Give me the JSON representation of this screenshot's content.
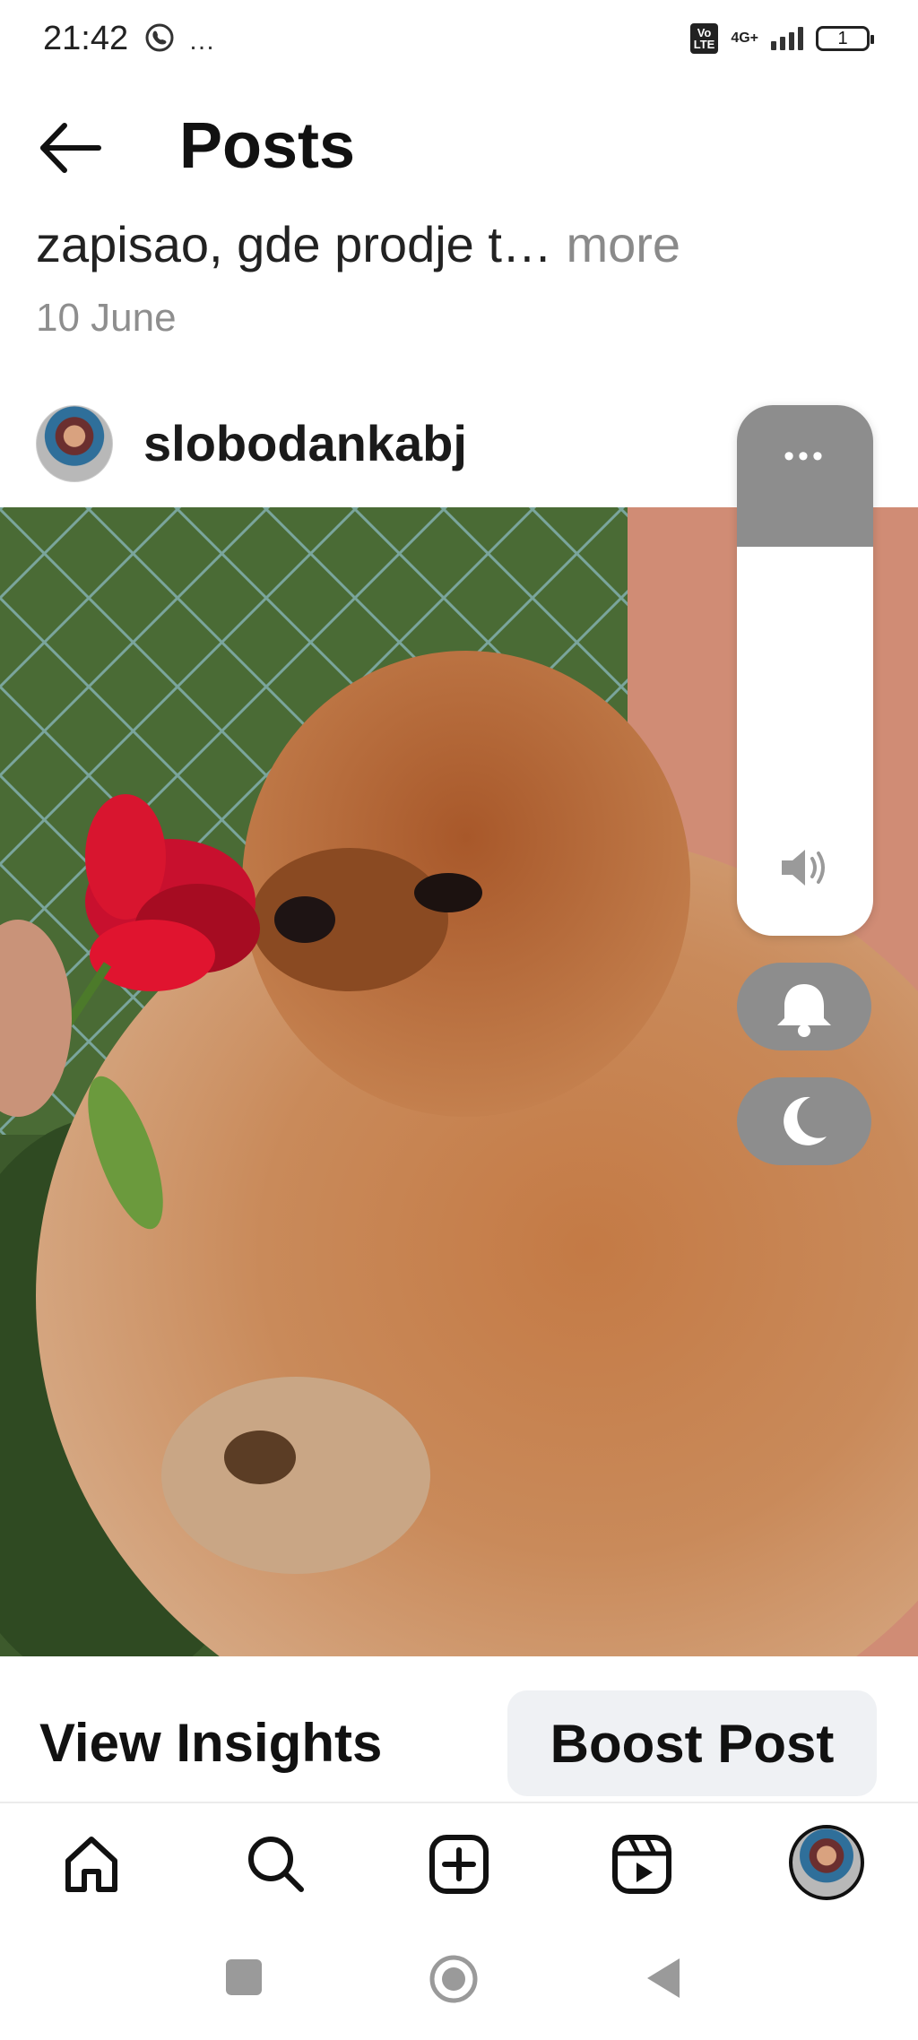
{
  "status_bar": {
    "time": "21:42",
    "extra": "…",
    "network_badge": "VoLTE",
    "network_type": "4G+",
    "battery": "1"
  },
  "header": {
    "title": "Posts"
  },
  "post": {
    "caption_text": "zapisao, gde prodje t…",
    "caption_more": "more",
    "date": "10 June",
    "author": "slobodankabj"
  },
  "actions": {
    "insights_label": "View Insights",
    "boost_label": "Boost Post"
  },
  "volume_overlay": {
    "menu_dots": "•••",
    "level": 0.0
  },
  "icons": {
    "back": "arrow-left-icon",
    "home": "home-icon",
    "search": "search-icon",
    "create": "plus-square-icon",
    "reels": "reels-icon",
    "speaker": "speaker-icon",
    "bell": "bell-icon",
    "moon": "moon-icon"
  },
  "colors": {
    "overlay_gray": "#8d8d8d",
    "boost_bg": "#eff1f4",
    "secondary_text": "#8e8e8e"
  }
}
